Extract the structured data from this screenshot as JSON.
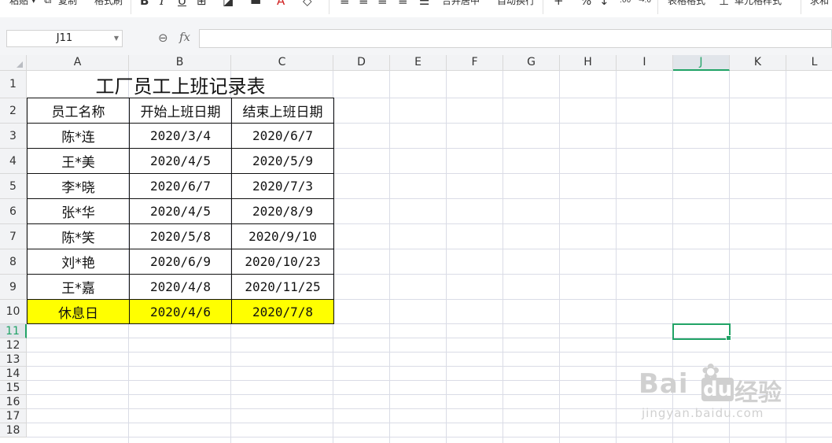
{
  "toolbar": {
    "paste": "粘贴",
    "copy": "复制",
    "format_painter": "格式刷",
    "merge_center": "合并居中",
    "wrap_text": "自动换行",
    "table_style": "表格格式",
    "cell_style": "单元格样式",
    "sum": "求和"
  },
  "formula_bar": {
    "name_box": "J11",
    "fx": "fx",
    "formula": ""
  },
  "columns": [
    "A",
    "B",
    "C",
    "D",
    "E",
    "F",
    "G",
    "H",
    "I",
    "J",
    "K",
    "L"
  ],
  "rows": [
    "1",
    "2",
    "3",
    "4",
    "5",
    "6",
    "7",
    "8",
    "9",
    "10",
    "11",
    "12",
    "13",
    "14",
    "15",
    "16",
    "17",
    "18"
  ],
  "active_cell": {
    "col": "J",
    "row": "11"
  },
  "sheet": {
    "title": "工厂员工上班记录表",
    "headers": [
      "员工名称",
      "开始上班日期",
      "结束上班日期"
    ],
    "records": [
      [
        "陈*连",
        "2020/3/4",
        "2020/6/7"
      ],
      [
        "王*美",
        "2020/4/5",
        "2020/5/9"
      ],
      [
        "李*晓",
        "2020/6/7",
        "2020/7/3"
      ],
      [
        "张*华",
        "2020/4/5",
        "2020/8/9"
      ],
      [
        "陈*笑",
        "2020/5/8",
        "2020/9/10"
      ],
      [
        "刘*艳",
        "2020/6/9",
        "2020/10/23"
      ],
      [
        "王*嘉",
        "2020/4/8",
        "2020/11/25"
      ]
    ],
    "holiday": [
      "休息日",
      "2020/4/6",
      "2020/7/8"
    ]
  },
  "colors": {
    "highlight": "#ffff00",
    "selection": "#21a366",
    "grid": "#dadce6"
  },
  "watermark": {
    "brand": "Bai",
    "brand_tail": "du",
    "suffix": "经验",
    "url": "jingyan.baidu.com"
  }
}
